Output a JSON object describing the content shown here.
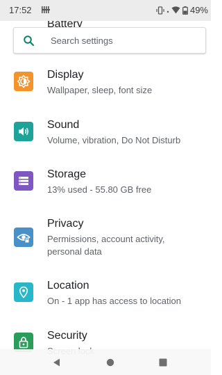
{
  "status_bar": {
    "time": "17:52",
    "battery_text": "49%",
    "icons": [
      "notification-icon",
      "vibrate-icon",
      "wifi-icon",
      "battery-icon"
    ]
  },
  "partial_item": {
    "title": "Battery"
  },
  "search": {
    "placeholder": "Search settings",
    "icon": "search-icon"
  },
  "colors": {
    "display": "#f4922b",
    "sound": "#1fa29a",
    "storage": "#7e57c2",
    "privacy": "#4a90c8",
    "location": "#26b8c8",
    "security": "#2a9d5b",
    "search_accent": "#12806f"
  },
  "items": [
    {
      "title": "Display",
      "summary": "Wallpaper, sleep, font size",
      "icon": "brightness-icon"
    },
    {
      "title": "Sound",
      "summary": "Volume, vibration, Do Not Disturb",
      "icon": "volume-icon"
    },
    {
      "title": "Storage",
      "summary": "13% used - 55.80 GB free",
      "icon": "storage-icon"
    },
    {
      "title": "Privacy",
      "summary": "Permissions, account activity,",
      "summary2": "personal data",
      "icon": "privacy-eye-icon"
    },
    {
      "title": "Location",
      "summary": "On - 1 app has access to location",
      "icon": "location-pin-icon"
    },
    {
      "title": "Security",
      "summary": "Screen lock",
      "icon": "lock-icon"
    }
  ],
  "nav_bar": {
    "buttons": [
      "back-icon",
      "home-icon",
      "recents-icon"
    ]
  }
}
